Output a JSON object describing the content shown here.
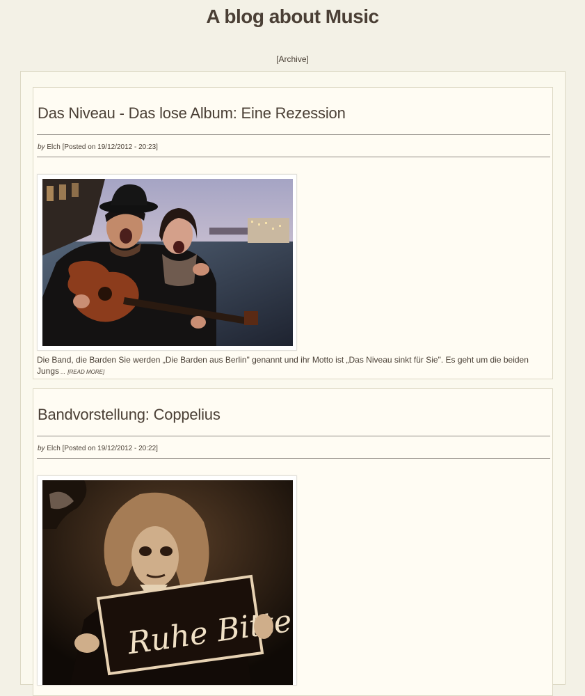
{
  "site": {
    "title": "A blog about Music",
    "archive_link": "[Archive]"
  },
  "posts": [
    {
      "title": "Das Niveau - Das lose Album: Eine Rezession",
      "by_label": "by",
      "author": "Elch",
      "posted": "[Posted on 19/12/2012 - 20:23]",
      "excerpt": "Die Band, die Barden Sie werden „Die Barden aus Berlin\" genannt und ihr Motto ist „Das Niveau sinkt für Sie\". Es geht um die beiden Jungs",
      "ellipsis": " ...",
      "read_more": "[READ MORE]",
      "image_alt": "two musicians with guitar"
    },
    {
      "title": "Bandvorstellung: Coppelius",
      "by_label": "by",
      "author": "Elch",
      "posted": "[Posted on 19/12/2012 - 20:22]",
      "image_alt": "musician holding sign",
      "image_sign_text": "Ruhe Bitte"
    }
  ],
  "colors": {
    "background": "#f3f1e6",
    "text": "#4a4036",
    "post_background": "#fffcf3",
    "border": "#dcd8c4"
  }
}
